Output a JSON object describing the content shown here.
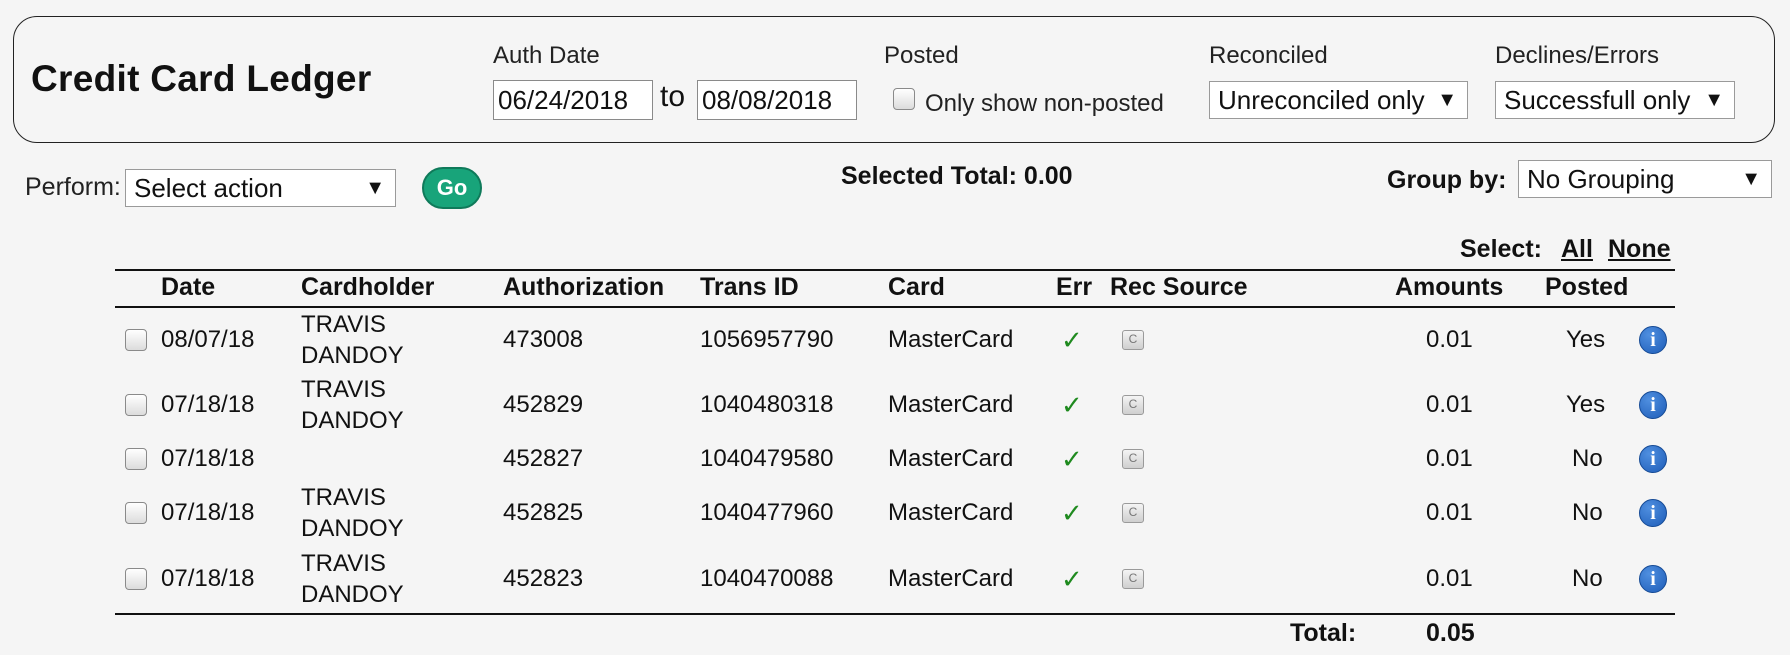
{
  "title": "Credit Card Ledger",
  "filters": {
    "auth_date_label": "Auth Date",
    "date_from": "06/24/2018",
    "to_label": "to",
    "date_to": "08/08/2018",
    "posted_label": "Posted",
    "only_non_posted_label": "Only show non-posted",
    "reconciled_label": "Reconciled",
    "reconciled_value": "Unreconciled only",
    "declines_label": "Declines/Errors",
    "declines_value": "Successfull only"
  },
  "toolbar": {
    "perform_label": "Perform:",
    "action_value": "Select action",
    "go_label": "Go",
    "selected_total": "Selected Total: 0.00",
    "group_by_label": "Group by:",
    "group_by_value": "No Grouping",
    "select_label": "Select:",
    "select_all": "All",
    "select_none": "None"
  },
  "table": {
    "columns": [
      "Date",
      "Cardholder",
      "Authorization",
      "Trans ID",
      "Card",
      "Err",
      "Rec Source",
      "Amounts",
      "Posted"
    ],
    "rows": [
      {
        "date": "08/07/18",
        "cardholder_1": "TRAVIS",
        "cardholder_2": "DANDOY",
        "authorization": "473008",
        "trans_id": "1056957790",
        "card": "MasterCard",
        "err": "✓",
        "rec": "C",
        "amount": "0.01",
        "posted": "Yes"
      },
      {
        "date": "07/18/18",
        "cardholder_1": "TRAVIS",
        "cardholder_2": "DANDOY",
        "authorization": "452829",
        "trans_id": "1040480318",
        "card": "MasterCard",
        "err": "✓",
        "rec": "C",
        "amount": "0.01",
        "posted": "Yes"
      },
      {
        "date": "07/18/18",
        "cardholder_1": "",
        "cardholder_2": "",
        "authorization": "452827",
        "trans_id": "1040479580",
        "card": "MasterCard",
        "err": "✓",
        "rec": "C",
        "amount": "0.01",
        "posted": "No"
      },
      {
        "date": "07/18/18",
        "cardholder_1": "TRAVIS",
        "cardholder_2": "DANDOY",
        "authorization": "452825",
        "trans_id": "1040477960",
        "card": "MasterCard",
        "err": "✓",
        "rec": "C",
        "amount": "0.01",
        "posted": "No"
      },
      {
        "date": "07/18/18",
        "cardholder_1": "TRAVIS",
        "cardholder_2": "DANDOY",
        "authorization": "452823",
        "trans_id": "1040470088",
        "card": "MasterCard",
        "err": "✓",
        "rec": "C",
        "amount": "0.01",
        "posted": "No"
      }
    ],
    "total_label": "Total:",
    "total_value": "0.05",
    "info_glyph": "i"
  },
  "colors": {
    "go_button": "#18a47a",
    "check": "#1f8a1f",
    "info_icon": "#1e5db8"
  }
}
